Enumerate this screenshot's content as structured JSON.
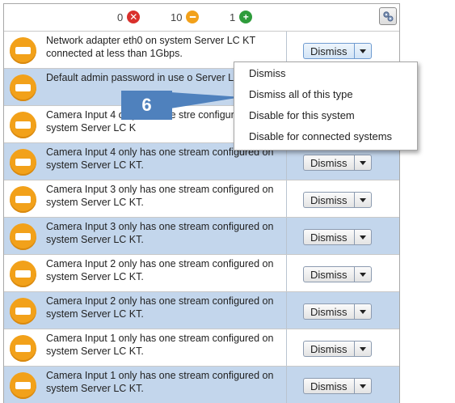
{
  "toolbar": {
    "counts": [
      {
        "value": "0",
        "icon": "error-x-icon",
        "color": "#d9302c",
        "glyph": "✕"
      },
      {
        "value": "10",
        "icon": "warning-dash-icon",
        "color": "#f2a11a",
        "glyph": "━"
      },
      {
        "value": "1",
        "icon": "info-plus-icon",
        "color": "#2e9c3b",
        "glyph": "+"
      }
    ],
    "settings_icon": "settings-gears-icon"
  },
  "alerts": [
    {
      "message": "Network adapter eth0 on system Server LC KT connected at less than 1Gbps.",
      "button": "Dismiss",
      "shaded": false,
      "icon": "warning-icon"
    },
    {
      "message": "Default admin password in use o Server LC KT.",
      "button": "Dismiss",
      "shaded": true,
      "icon": "warning-icon"
    },
    {
      "message": "Camera Input 4 only has one stre configured on system Server LC K",
      "button": "Dismiss",
      "shaded": false,
      "icon": "warning-icon"
    },
    {
      "message": "Camera Input 4 only has one stream configured on system Server LC KT.",
      "button": "Dismiss",
      "shaded": true,
      "icon": "warning-icon"
    },
    {
      "message": "Camera Input 3 only has one stream configured on system Server LC KT.",
      "button": "Dismiss",
      "shaded": false,
      "icon": "warning-icon"
    },
    {
      "message": "Camera Input 3 only has one stream configured on system Server LC KT.",
      "button": "Dismiss",
      "shaded": true,
      "icon": "warning-icon"
    },
    {
      "message": "Camera Input 2 only has one stream configured on system Server LC KT.",
      "button": "Dismiss",
      "shaded": false,
      "icon": "warning-icon"
    },
    {
      "message": "Camera Input 2 only has one stream configured on system Server LC KT.",
      "button": "Dismiss",
      "shaded": true,
      "icon": "warning-icon"
    },
    {
      "message": "Camera Input 1 only has one stream configured on system Server LC KT.",
      "button": "Dismiss",
      "shaded": false,
      "icon": "warning-icon"
    },
    {
      "message": "Camera Input 1 only has one stream configured on system Server LC KT.",
      "button": "Dismiss",
      "shaded": true,
      "icon": "warning-icon"
    }
  ],
  "dropdown_menu": {
    "items": [
      "Dismiss",
      "Dismiss all of this type",
      "Disable for this system",
      "Disable for connected systems"
    ]
  },
  "callout": {
    "label": "6",
    "color": "#4f81bd"
  }
}
